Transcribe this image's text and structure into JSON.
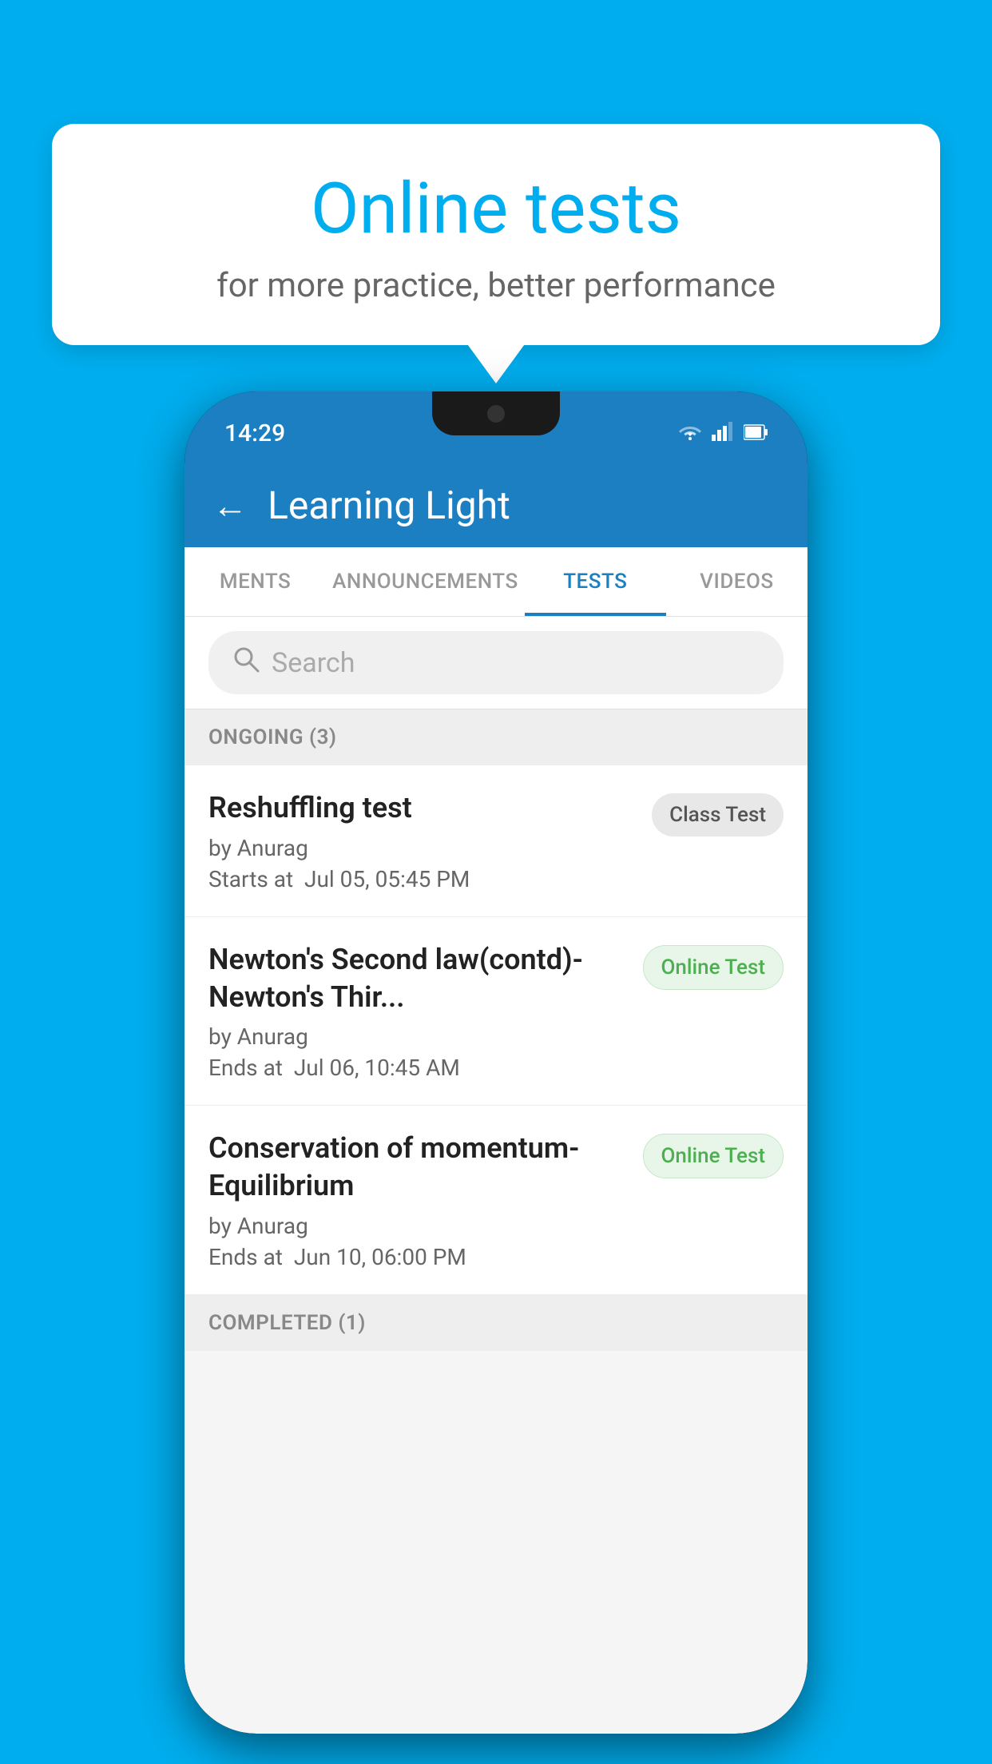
{
  "background": {
    "color": "#00AEEF"
  },
  "bubble": {
    "title": "Online tests",
    "subtitle": "for more practice, better performance"
  },
  "phone": {
    "status_bar": {
      "time": "14:29",
      "icons": [
        "wifi",
        "signal",
        "battery"
      ]
    },
    "header": {
      "back_label": "←",
      "title": "Learning Light"
    },
    "tabs": [
      {
        "label": "MENTS",
        "active": false
      },
      {
        "label": "ANNOUNCEMENTS",
        "active": false
      },
      {
        "label": "TESTS",
        "active": true
      },
      {
        "label": "VIDEOS",
        "active": false
      }
    ],
    "search": {
      "placeholder": "Search"
    },
    "sections": [
      {
        "title": "ONGOING (3)",
        "items": [
          {
            "name": "Reshuffling test",
            "author": "by Anurag",
            "time_label": "Starts at",
            "time": "Jul 05, 05:45 PM",
            "badge": "Class Test",
            "badge_type": "class"
          },
          {
            "name": "Newton's Second law(contd)-Newton's Thir...",
            "author": "by Anurag",
            "time_label": "Ends at",
            "time": "Jul 06, 10:45 AM",
            "badge": "Online Test",
            "badge_type": "online"
          },
          {
            "name": "Conservation of momentum-Equilibrium",
            "author": "by Anurag",
            "time_label": "Ends at",
            "time": "Jun 10, 06:00 PM",
            "badge": "Online Test",
            "badge_type": "online"
          }
        ]
      }
    ],
    "completed_section_label": "COMPLETED (1)"
  }
}
